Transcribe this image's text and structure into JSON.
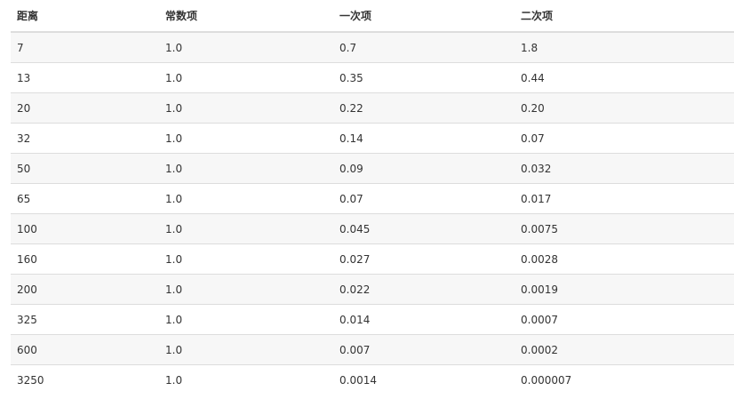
{
  "table": {
    "headers": [
      "距离",
      "常数项",
      "一次项",
      "二次项"
    ],
    "rows": [
      [
        "7",
        "1.0",
        "0.7",
        "1.8"
      ],
      [
        "13",
        "1.0",
        "0.35",
        "0.44"
      ],
      [
        "20",
        "1.0",
        "0.22",
        "0.20"
      ],
      [
        "32",
        "1.0",
        "0.14",
        "0.07"
      ],
      [
        "50",
        "1.0",
        "0.09",
        "0.032"
      ],
      [
        "65",
        "1.0",
        "0.07",
        "0.017"
      ],
      [
        "100",
        "1.0",
        "0.045",
        "0.0075"
      ],
      [
        "160",
        "1.0",
        "0.027",
        "0.0028"
      ],
      [
        "200",
        "1.0",
        "0.022",
        "0.0019"
      ],
      [
        "325",
        "1.0",
        "0.014",
        "0.0007"
      ],
      [
        "600",
        "1.0",
        "0.007",
        "0.0002"
      ],
      [
        "3250",
        "1.0",
        "0.0014",
        "0.000007"
      ]
    ]
  }
}
